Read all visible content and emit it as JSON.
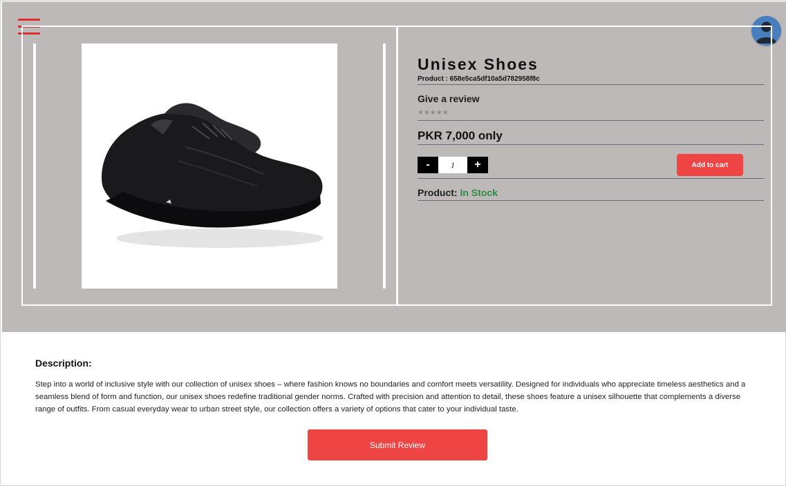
{
  "product": {
    "title": "Unisex Shoes",
    "id_label": "Product : 658e5ca5df10a5d782958f8c",
    "review_label": "Give a review",
    "stars": "★★★★★",
    "rating": 0,
    "price": "PKR 7,000 only",
    "quantity": "1",
    "qty_minus": "-",
    "qty_plus": "+",
    "add_to_cart": "Add to cart",
    "stock_label": "Product:",
    "stock_status": "In Stock"
  },
  "description": {
    "title": "Description:",
    "text": "Step into a world of inclusive style with our collection of unisex shoes – where fashion knows no boundaries and comfort meets versatility. Designed for individuals who appreciate timeless aesthetics and a seamless blend of form and function, our unisex shoes redefine traditional gender norms. Crafted with precision and attention to detail, these shoes feature a unisex silhouette that complements a diverse range of outfits. From casual everyday wear to urban street style, our collection offers a variety of options that cater to your individual taste."
  },
  "actions": {
    "submit_review": "Submit Review"
  },
  "icons": {
    "menu": "hamburger-menu-icon",
    "user": "user-avatar-icon"
  },
  "colors": {
    "accent_red": "#ef4444",
    "panel_grey": "#bdb9b8",
    "stock_green": "#2e8b45"
  }
}
